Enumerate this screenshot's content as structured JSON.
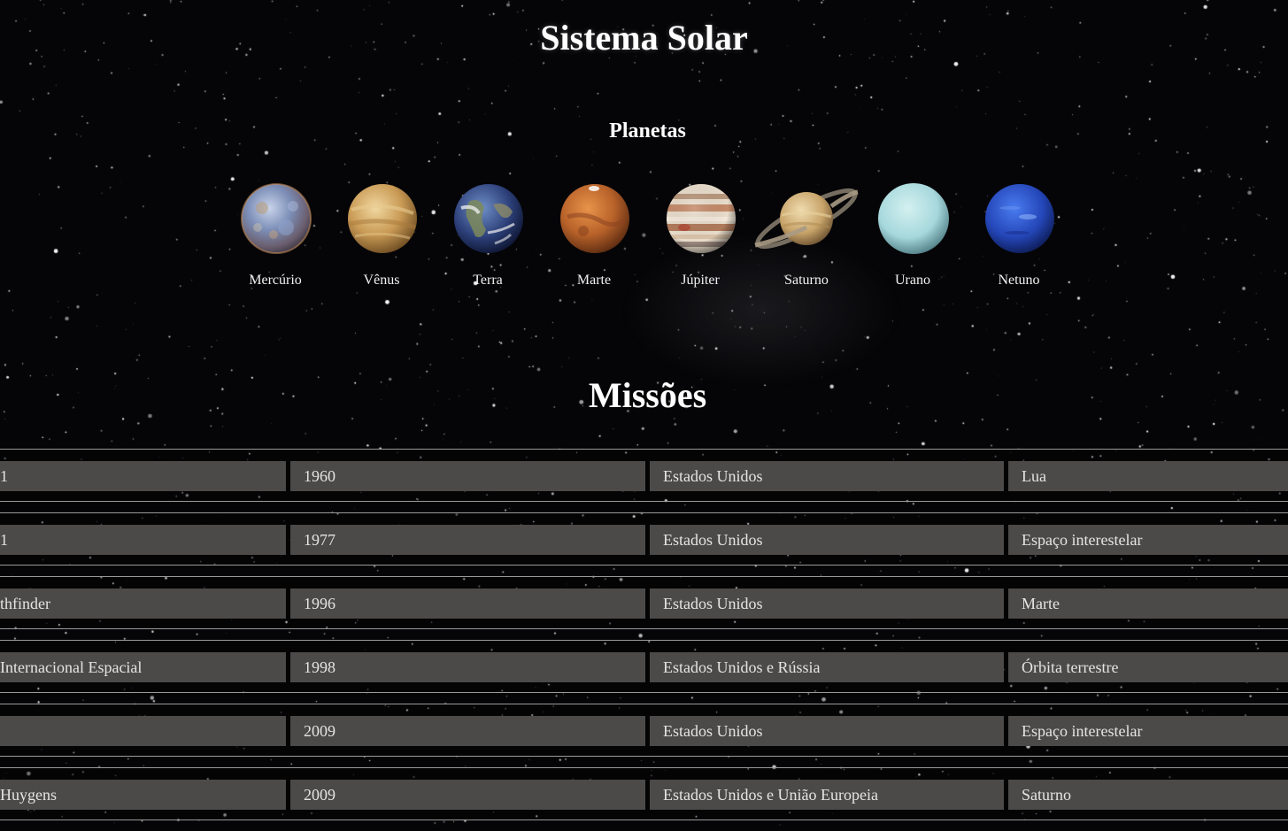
{
  "page": {
    "title": "Sistema Solar",
    "planets_heading": "Planetas",
    "missions_heading": "Missões"
  },
  "planets": [
    {
      "name": "Mercúrio",
      "icon": "mercury-icon"
    },
    {
      "name": "Vênus",
      "icon": "venus-icon"
    },
    {
      "name": "Terra",
      "icon": "earth-icon"
    },
    {
      "name": "Marte",
      "icon": "mars-icon"
    },
    {
      "name": "Júpiter",
      "icon": "jupiter-icon"
    },
    {
      "name": "Saturno",
      "icon": "saturn-icon"
    },
    {
      "name": "Urano",
      "icon": "uranus-icon"
    },
    {
      "name": "Netuno",
      "icon": "neptune-icon"
    }
  ],
  "missions": [
    {
      "name": "1",
      "year": "1960",
      "country": "Estados Unidos",
      "target": "Lua"
    },
    {
      "name": "1",
      "year": "1977",
      "country": "Estados Unidos",
      "target": "Espaço interestelar"
    },
    {
      "name": "thfinder",
      "year": "1996",
      "country": "Estados Unidos",
      "target": "Marte"
    },
    {
      "name": "Internacional Espacial",
      "year": "1998",
      "country": "Estados Unidos e Rússia",
      "target": "Órbita terrestre"
    },
    {
      "name": "",
      "year": "2009",
      "country": "Estados Unidos",
      "target": "Espaço interestelar"
    },
    {
      "name": "Huygens",
      "year": "2009",
      "country": "Estados Unidos e União Europeia",
      "target": "Saturno"
    }
  ],
  "colors": {
    "background": "#050507",
    "table_cell": "#4c4a48",
    "table_text": "#e4e4e4",
    "row_border": "#9a9a9a"
  }
}
